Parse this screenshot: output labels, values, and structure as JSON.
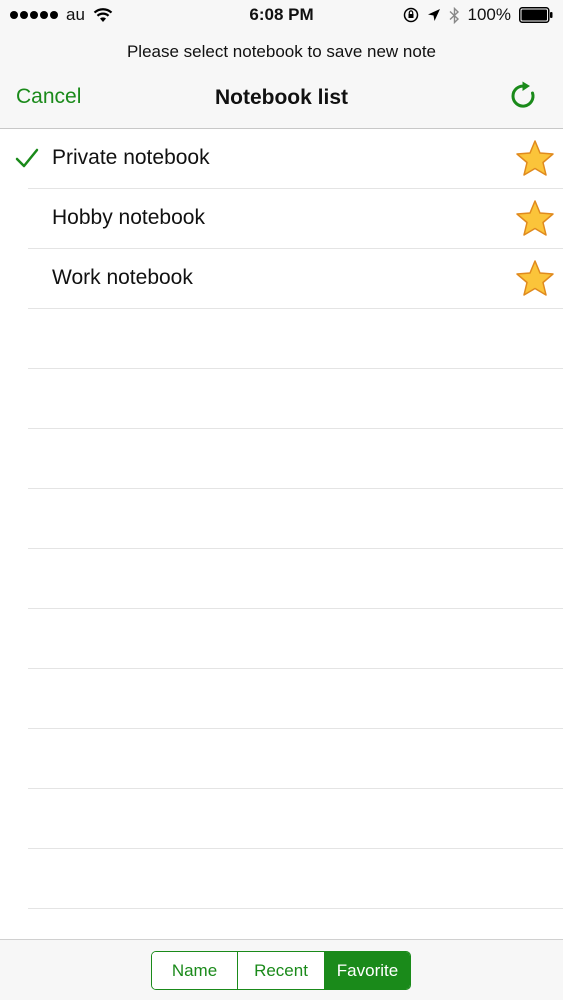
{
  "status_bar": {
    "carrier": "au",
    "time": "6:08 PM",
    "battery_percent": "100%"
  },
  "header": {
    "prompt": "Please select notebook to save new note",
    "title": "Notebook list",
    "cancel_label": "Cancel"
  },
  "notebooks": [
    {
      "name": "Private notebook",
      "selected": true,
      "favorite": true
    },
    {
      "name": "Hobby notebook",
      "selected": false,
      "favorite": true
    },
    {
      "name": "Work notebook",
      "selected": false,
      "favorite": true
    }
  ],
  "sort_tabs": {
    "name_label": "Name",
    "recent_label": "Recent",
    "favorite_label": "Favorite",
    "active": "Favorite"
  },
  "colors": {
    "accent": "#1a8a1a",
    "star_fill": "#fbc43a",
    "star_stroke": "#e08a1e"
  }
}
